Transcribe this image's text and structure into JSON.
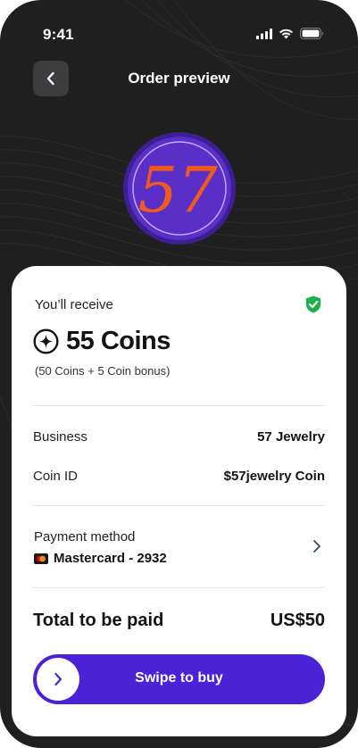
{
  "status_bar": {
    "time": "9:41"
  },
  "header": {
    "title": "Order preview"
  },
  "coin_logo": {
    "text": "57"
  },
  "receive": {
    "label": "You’ll receive",
    "amount": "55 Coins",
    "bonus": "(50 Coins + 5 Coin bonus)"
  },
  "details": [
    {
      "label": "Business",
      "value": "57 Jewelry"
    },
    {
      "label": "Coin ID",
      "value": "$57jewelry Coin"
    }
  ],
  "payment": {
    "label": "Payment method",
    "card": "Mastercard - 2932"
  },
  "total": {
    "label": "Total to be paid",
    "value": "US$50"
  },
  "swipe": {
    "label": "Swipe to buy"
  },
  "colors": {
    "background": "#1f1f20",
    "accent": "#4b22d6",
    "coin_purple": "#5a2fc7",
    "coin_orange": "#f05a1e",
    "shield_green": "#1cb04a"
  }
}
